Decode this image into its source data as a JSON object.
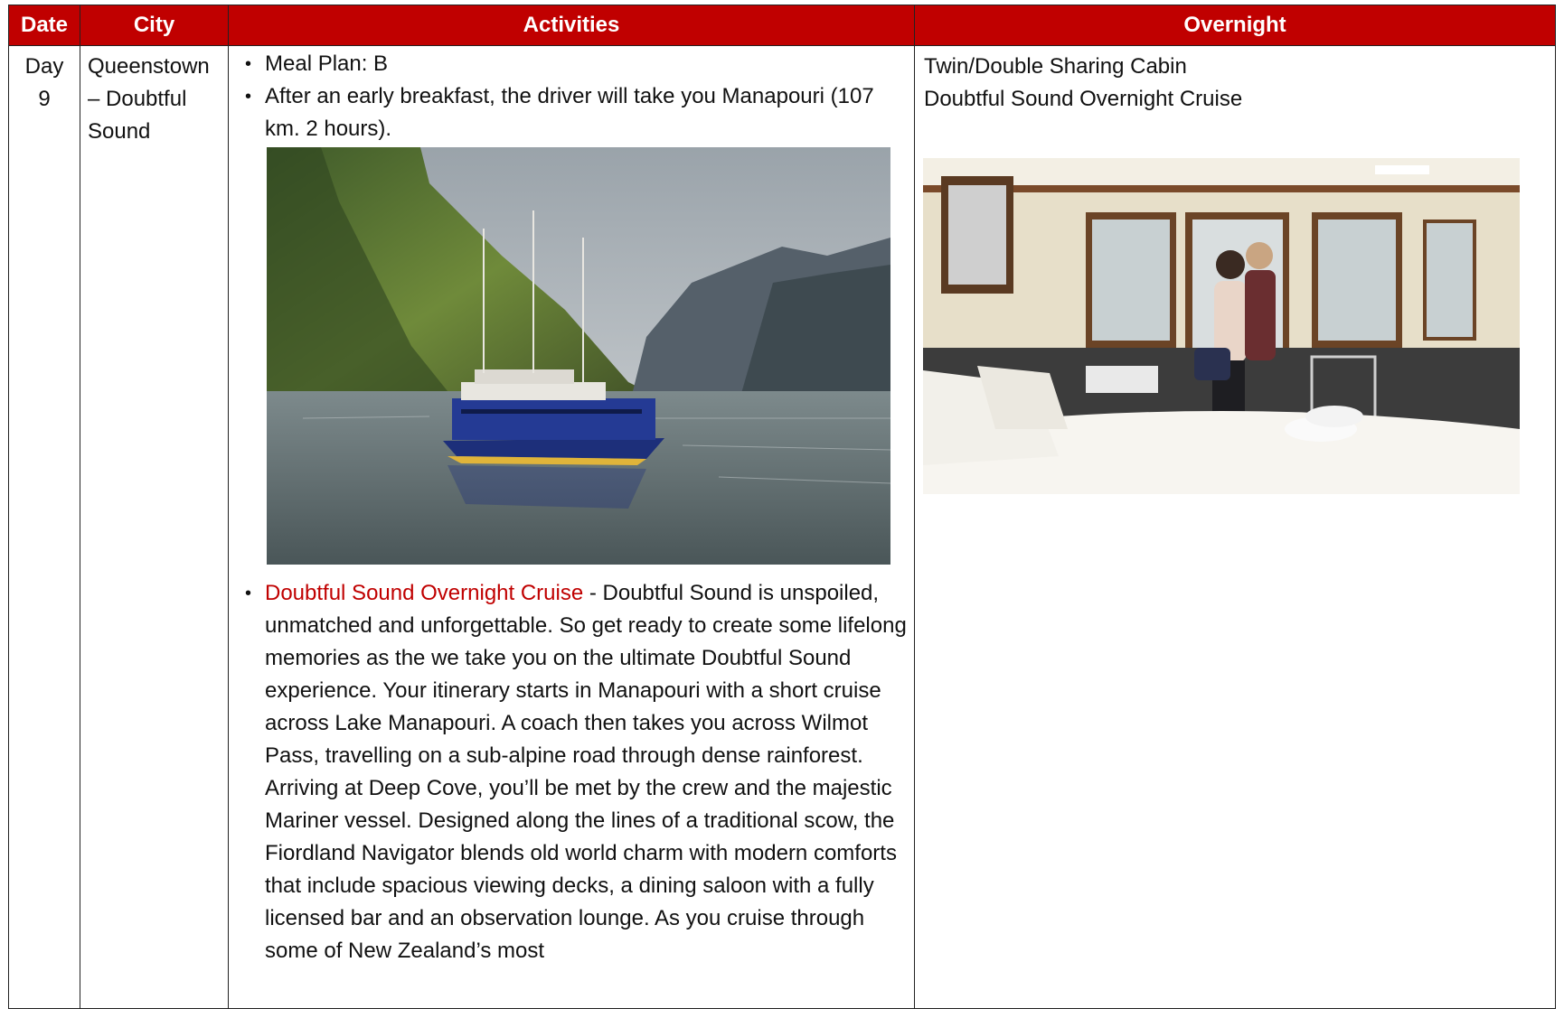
{
  "table": {
    "headers": {
      "date": "Date",
      "city": "City",
      "activities": "Activities",
      "overnight": "Overnight"
    },
    "row": {
      "date_line1": "Day",
      "date_line2": "9",
      "city": "Queenstown – Doubtful Sound",
      "activities": {
        "meal_plan": "Meal Plan: B",
        "transfer": "After an early breakfast, the driver will take you Manapouri (107 km. 2 hours).",
        "cruise_link": "Doubtful Sound Overnight Cruise",
        "cruise_text": " - Doubtful Sound is unspoiled, unmatched and unforgettable. So get ready to create some lifelong memories as the we take you on the ultimate Doubtful Sound experience. Your itinerary starts in Manapouri with a short cruise across Lake Manapouri. A coach then takes you across Wilmot Pass, travelling on a sub-alpine road through dense rainforest. Arriving at Deep Cove, you’ll be met by the crew and the majestic Mariner vessel. Designed along the lines of a traditional scow, the Fiordland Navigator blends old world charm with modern comforts that include spacious viewing decks, a dining saloon with a fully licensed bar and an observation lounge. As you cruise through some of New Zealand’s most"
      },
      "overnight": {
        "room": "Twin/Double Sharing Cabin",
        "accommodation": "Doubtful Sound Overnight Cruise"
      }
    }
  },
  "colors": {
    "header_bg": "#c00000",
    "header_text": "#ffffff",
    "link": "#c00000"
  },
  "icons": {
    "bullet": "•"
  }
}
